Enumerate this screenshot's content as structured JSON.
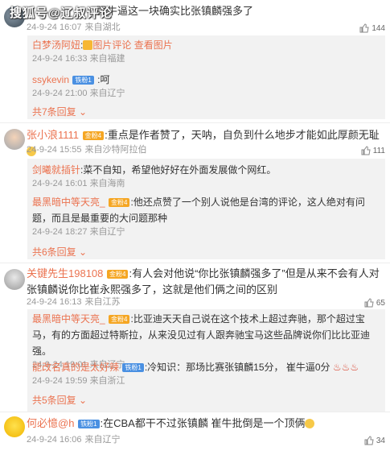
{
  "watermark": "搜狐号@辽叔评论",
  "comments": [
    {
      "text_tail": "强牛逼这一块确实比张镇麟强多了",
      "date": "24-9-24 16:07",
      "source": "来自湖北",
      "likes": "144",
      "replies": [
        {
          "user": "白梦汤阿妞",
          "mid": ":",
          "text": "图片评论",
          "link": "查看图片",
          "date": "24-9-24 16:33",
          "source": "来自福建"
        },
        {
          "user": "ssykevin",
          "badge": "铁粉1",
          "text": ":呵",
          "date": "24-9-24 21:00",
          "source": "来自辽宁"
        }
      ],
      "more": "共7条回复"
    },
    {
      "user": "张小浪1111",
      "badge": "金粉4",
      "text": ":重点是作者赞了，天呐，自负到什么地步才能如此厚颜无耻",
      "date": "24-9-24 15:55",
      "source": "来自沙特阿拉伯",
      "likes": "111",
      "replies": [
        {
          "user": "剑曦就插针",
          "text": ":菜不自知，希望他好好在外面发展做个网红。",
          "date": "24-9-24 16:01",
          "source": "来自海南"
        },
        {
          "user": "最黑暗中等天亮_",
          "badge": "金粉4",
          "text": ":他还点赞了一个别人说他是台湾的评论，这人绝对有问题，而且是最重要的大问题那种",
          "date": "24-9-24 18:27",
          "source": "来自辽宁"
        }
      ],
      "more": "共6条回复"
    },
    {
      "user": "关键先生198108",
      "badge": "金粉4",
      "text": ":有人会对他说“你比张镇麟强多了”但是从来不会有人对张镇麟说你比崔永熙强多了，这就是他们俩之间的区别",
      "date": "24-9-24 16:13",
      "source": "来自江苏",
      "likes": "65",
      "replies": [
        {
          "user": "最黑暗中等天亮_",
          "badge": "金粉4",
          "text": ":比亚迪天天自己说在这个技术上超过奔驰，那个超过宝马，有的方面超过特斯拉，从来没见过有人跟奔驰宝马这些品牌说你们比比亚迪强。",
          "date": "24-9-24 19:01",
          "source": "来自辽宁"
        },
        {
          "user": "能改名真的是太好辣",
          "badge": "铁粉1",
          "text": ":冷知识：那场比赛张镇麟15分，  崔牛逼0分",
          "date": "24-9-24 19:59",
          "source": "来自浙江"
        }
      ],
      "more": "共5条回复"
    },
    {
      "user": "何必憶@h",
      "badge": "铁粉1",
      "text": ":在CBA都干不过张镇麟  崔牛批倒是一个顶俩",
      "date": "24-9-24 16:06",
      "source": "来自辽宁",
      "likes": "34"
    }
  ]
}
